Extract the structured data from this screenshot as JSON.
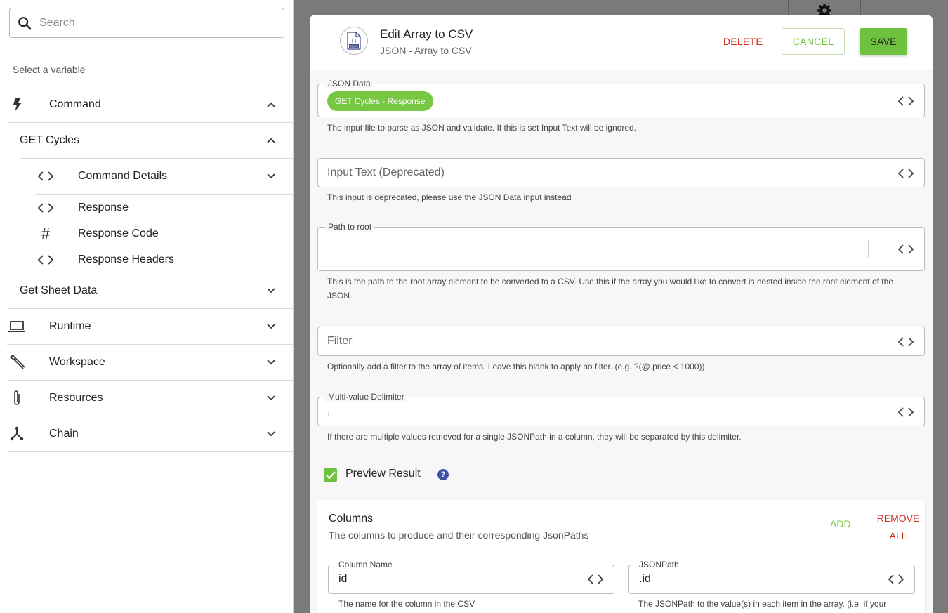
{
  "sidebar": {
    "search_placeholder": "Search",
    "select_label": "Select a variable",
    "groups": {
      "command": "Command",
      "get_cycles": "GET Cycles",
      "command_details": "Command Details",
      "response": "Response",
      "response_code": "Response Code",
      "response_headers": "Response Headers",
      "get_sheet_data": "Get Sheet Data",
      "runtime": "Runtime",
      "workspace": "Workspace",
      "resources": "Resources",
      "chain": "Chain"
    }
  },
  "modal": {
    "title": "Edit Array to CSV",
    "subtitle": "JSON - Array to CSV",
    "badge_text": "JSON",
    "delete_label": "DELETE",
    "cancel_label": "CANCEL",
    "save_label": "SAVE",
    "json_data": {
      "label": "JSON Data",
      "chip": "GET Cycles - Response",
      "help": "The input file to parse as JSON and validate. If this is set Input Text will be ignored."
    },
    "input_text": {
      "placeholder": "Input Text (Deprecated)",
      "help": "This input is deprecated, please use the JSON Data input instead"
    },
    "path_to_root": {
      "label": "Path to root",
      "help": "This is the path to the root array element to be converted to a CSV. Use this if the array you would like to convert is nested inside the root element of the JSON."
    },
    "filter": {
      "placeholder": "Filter",
      "help": "Optionally add a filter to the array of items. Leave this blank to apply no filter. (e.g. ?(@.price < 1000))"
    },
    "delimiter": {
      "label": "Multi-value Delimiter",
      "value": ",",
      "help": "If there are multiple values retrieved for a single JSONPath in a column, they will be separated by this delimiter."
    },
    "preview": {
      "label": "Preview Result",
      "checked": true,
      "help_icon": "?"
    },
    "columns": {
      "title": "Columns",
      "subtitle": "The columns to produce and their corresponding JsonPaths",
      "add_label": "ADD",
      "remove_label_line1": "REMOVE",
      "remove_label_line2": "ALL",
      "column_name_label": "Column Name",
      "column_name_value": "id",
      "column_name_help": "The name for the column in the CSV",
      "jsonpath_label": "JSONPath",
      "jsonpath_value": ".id",
      "jsonpath_help": "The JSONPath to the value(s) in each item in the array. (i.e. if your"
    }
  },
  "colors": {
    "accent_green": "#6ec23f",
    "danger_red": "#d6291f",
    "help_blue": "#3f51a5"
  },
  "icons": [
    "search-icon",
    "bolt-icon",
    "chevron-up-icon",
    "chevron-down-icon",
    "code-icon",
    "hash-icon",
    "laptop-icon",
    "wrench-icon",
    "paperclip-icon",
    "chain-icon",
    "gear-icon",
    "json-file-icon",
    "checkmark-icon",
    "help-icon"
  ]
}
